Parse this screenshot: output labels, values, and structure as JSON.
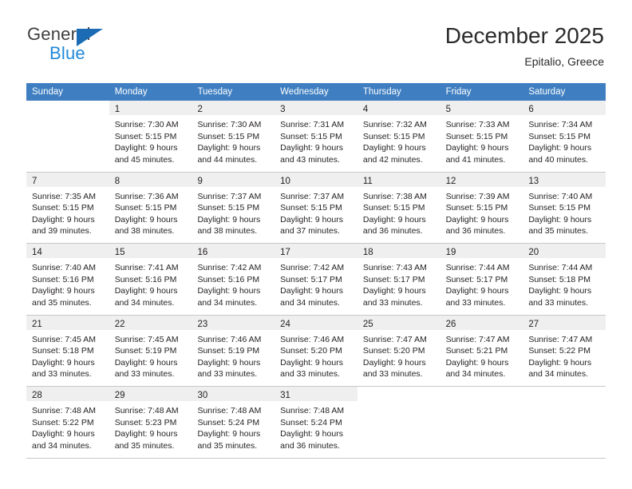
{
  "brand": {
    "name_top": "General",
    "name_bottom": "Blue",
    "triangle_color": "#1c6cb5",
    "top_color": "#3f3f3f",
    "bottom_color": "#2389d8"
  },
  "header": {
    "title": "December 2025",
    "subtitle": "Epitalio, Greece"
  },
  "colors": {
    "header_row_bg": "#3f7fc1",
    "header_row_text": "#ffffff",
    "day_number_band": "#efefef",
    "grid_line": "#c8c8c8",
    "body_text": "#231f20"
  },
  "weekdays": [
    "Sunday",
    "Monday",
    "Tuesday",
    "Wednesday",
    "Thursday",
    "Friday",
    "Saturday"
  ],
  "weeks": [
    [
      {
        "day": "",
        "lines": []
      },
      {
        "day": "1",
        "lines": [
          "Sunrise: 7:30 AM",
          "Sunset: 5:15 PM",
          "Daylight: 9 hours",
          "and 45 minutes."
        ]
      },
      {
        "day": "2",
        "lines": [
          "Sunrise: 7:30 AM",
          "Sunset: 5:15 PM",
          "Daylight: 9 hours",
          "and 44 minutes."
        ]
      },
      {
        "day": "3",
        "lines": [
          "Sunrise: 7:31 AM",
          "Sunset: 5:15 PM",
          "Daylight: 9 hours",
          "and 43 minutes."
        ]
      },
      {
        "day": "4",
        "lines": [
          "Sunrise: 7:32 AM",
          "Sunset: 5:15 PM",
          "Daylight: 9 hours",
          "and 42 minutes."
        ]
      },
      {
        "day": "5",
        "lines": [
          "Sunrise: 7:33 AM",
          "Sunset: 5:15 PM",
          "Daylight: 9 hours",
          "and 41 minutes."
        ]
      },
      {
        "day": "6",
        "lines": [
          "Sunrise: 7:34 AM",
          "Sunset: 5:15 PM",
          "Daylight: 9 hours",
          "and 40 minutes."
        ]
      }
    ],
    [
      {
        "day": "7",
        "lines": [
          "Sunrise: 7:35 AM",
          "Sunset: 5:15 PM",
          "Daylight: 9 hours",
          "and 39 minutes."
        ]
      },
      {
        "day": "8",
        "lines": [
          "Sunrise: 7:36 AM",
          "Sunset: 5:15 PM",
          "Daylight: 9 hours",
          "and 38 minutes."
        ]
      },
      {
        "day": "9",
        "lines": [
          "Sunrise: 7:37 AM",
          "Sunset: 5:15 PM",
          "Daylight: 9 hours",
          "and 38 minutes."
        ]
      },
      {
        "day": "10",
        "lines": [
          "Sunrise: 7:37 AM",
          "Sunset: 5:15 PM",
          "Daylight: 9 hours",
          "and 37 minutes."
        ]
      },
      {
        "day": "11",
        "lines": [
          "Sunrise: 7:38 AM",
          "Sunset: 5:15 PM",
          "Daylight: 9 hours",
          "and 36 minutes."
        ]
      },
      {
        "day": "12",
        "lines": [
          "Sunrise: 7:39 AM",
          "Sunset: 5:15 PM",
          "Daylight: 9 hours",
          "and 36 minutes."
        ]
      },
      {
        "day": "13",
        "lines": [
          "Sunrise: 7:40 AM",
          "Sunset: 5:15 PM",
          "Daylight: 9 hours",
          "and 35 minutes."
        ]
      }
    ],
    [
      {
        "day": "14",
        "lines": [
          "Sunrise: 7:40 AM",
          "Sunset: 5:16 PM",
          "Daylight: 9 hours",
          "and 35 minutes."
        ]
      },
      {
        "day": "15",
        "lines": [
          "Sunrise: 7:41 AM",
          "Sunset: 5:16 PM",
          "Daylight: 9 hours",
          "and 34 minutes."
        ]
      },
      {
        "day": "16",
        "lines": [
          "Sunrise: 7:42 AM",
          "Sunset: 5:16 PM",
          "Daylight: 9 hours",
          "and 34 minutes."
        ]
      },
      {
        "day": "17",
        "lines": [
          "Sunrise: 7:42 AM",
          "Sunset: 5:17 PM",
          "Daylight: 9 hours",
          "and 34 minutes."
        ]
      },
      {
        "day": "18",
        "lines": [
          "Sunrise: 7:43 AM",
          "Sunset: 5:17 PM",
          "Daylight: 9 hours",
          "and 33 minutes."
        ]
      },
      {
        "day": "19",
        "lines": [
          "Sunrise: 7:44 AM",
          "Sunset: 5:17 PM",
          "Daylight: 9 hours",
          "and 33 minutes."
        ]
      },
      {
        "day": "20",
        "lines": [
          "Sunrise: 7:44 AM",
          "Sunset: 5:18 PM",
          "Daylight: 9 hours",
          "and 33 minutes."
        ]
      }
    ],
    [
      {
        "day": "21",
        "lines": [
          "Sunrise: 7:45 AM",
          "Sunset: 5:18 PM",
          "Daylight: 9 hours",
          "and 33 minutes."
        ]
      },
      {
        "day": "22",
        "lines": [
          "Sunrise: 7:45 AM",
          "Sunset: 5:19 PM",
          "Daylight: 9 hours",
          "and 33 minutes."
        ]
      },
      {
        "day": "23",
        "lines": [
          "Sunrise: 7:46 AM",
          "Sunset: 5:19 PM",
          "Daylight: 9 hours",
          "and 33 minutes."
        ]
      },
      {
        "day": "24",
        "lines": [
          "Sunrise: 7:46 AM",
          "Sunset: 5:20 PM",
          "Daylight: 9 hours",
          "and 33 minutes."
        ]
      },
      {
        "day": "25",
        "lines": [
          "Sunrise: 7:47 AM",
          "Sunset: 5:20 PM",
          "Daylight: 9 hours",
          "and 33 minutes."
        ]
      },
      {
        "day": "26",
        "lines": [
          "Sunrise: 7:47 AM",
          "Sunset: 5:21 PM",
          "Daylight: 9 hours",
          "and 34 minutes."
        ]
      },
      {
        "day": "27",
        "lines": [
          "Sunrise: 7:47 AM",
          "Sunset: 5:22 PM",
          "Daylight: 9 hours",
          "and 34 minutes."
        ]
      }
    ],
    [
      {
        "day": "28",
        "lines": [
          "Sunrise: 7:48 AM",
          "Sunset: 5:22 PM",
          "Daylight: 9 hours",
          "and 34 minutes."
        ]
      },
      {
        "day": "29",
        "lines": [
          "Sunrise: 7:48 AM",
          "Sunset: 5:23 PM",
          "Daylight: 9 hours",
          "and 35 minutes."
        ]
      },
      {
        "day": "30",
        "lines": [
          "Sunrise: 7:48 AM",
          "Sunset: 5:24 PM",
          "Daylight: 9 hours",
          "and 35 minutes."
        ]
      },
      {
        "day": "31",
        "lines": [
          "Sunrise: 7:48 AM",
          "Sunset: 5:24 PM",
          "Daylight: 9 hours",
          "and 36 minutes."
        ]
      },
      {
        "day": "",
        "lines": []
      },
      {
        "day": "",
        "lines": []
      },
      {
        "day": "",
        "lines": []
      }
    ]
  ]
}
